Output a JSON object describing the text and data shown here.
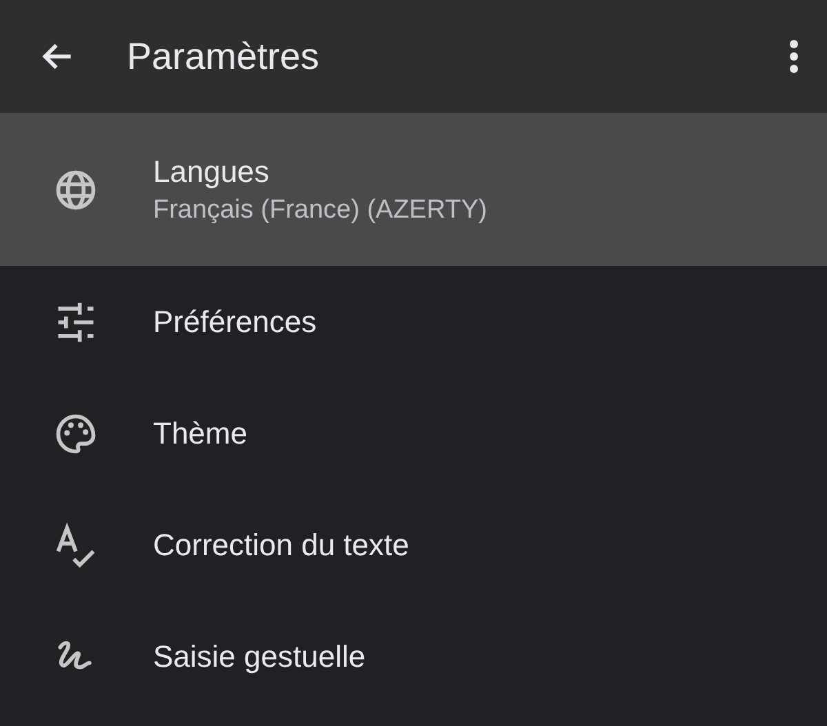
{
  "app_bar": {
    "title": "Paramètres"
  },
  "items": [
    {
      "label": "Langues",
      "subtitle": "Français (France) (AZERTY)",
      "selected": true
    },
    {
      "label": "Préférences",
      "selected": false
    },
    {
      "label": "Thème",
      "selected": false
    },
    {
      "label": "Correction du texte",
      "selected": false
    },
    {
      "label": "Saisie gestuelle",
      "selected": false
    }
  ]
}
